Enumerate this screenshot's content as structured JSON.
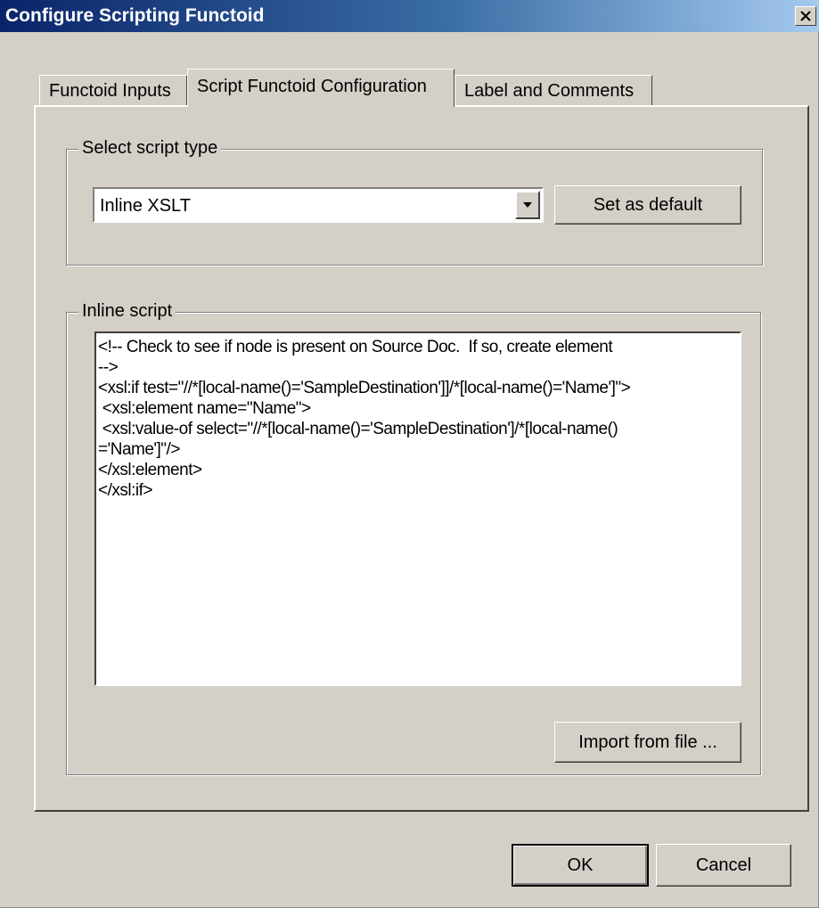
{
  "window": {
    "title": "Configure Scripting Functoid",
    "close_label": "X"
  },
  "tabs": [
    {
      "label": "Functoid Inputs",
      "active": false
    },
    {
      "label": "Script Functoid Configuration",
      "active": true
    },
    {
      "label": "Label and Comments",
      "active": false
    }
  ],
  "script_type": {
    "group_title": "Select script type",
    "selected": "Inline XSLT",
    "set_default_label": "Set as default"
  },
  "inline_script": {
    "group_title": "Inline script",
    "content": "<!-- Check to see if node is present on Source Doc.  If so, create element\n-->\n<xsl:if test=\"//*[local-name()='SampleDestination']]/*[local-name()='Name']\">\n <xsl:element name=\"Name\">\n <xsl:value-of select=\"//*[local-name()='SampleDestination']/*[local-name()\n='Name']\"/>\n</xsl:element>\n</xsl:if>",
    "import_label": "Import from file ..."
  },
  "footer": {
    "ok_label": "OK",
    "cancel_label": "Cancel"
  }
}
